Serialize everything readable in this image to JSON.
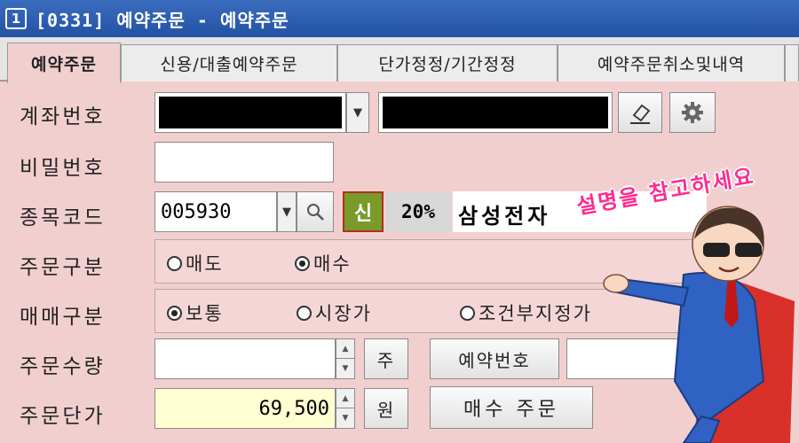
{
  "window": {
    "number": "1",
    "title": "[0331] 예약주문 - 예약주문"
  },
  "tabs": [
    {
      "label": "예약주문",
      "active": true
    },
    {
      "label": "신용/대출예약주문",
      "active": false
    },
    {
      "label": "단가정정/기간정정",
      "active": false
    },
    {
      "label": "예약주문취소및내역",
      "active": false
    }
  ],
  "form": {
    "account_label": "계좌번호",
    "password_label": "비밀번호",
    "stock_code_label": "종목코드",
    "stock_code_value": "005930",
    "credit_badge": "신",
    "margin_rate": "20%",
    "stock_name": "삼성전자",
    "order_type_label": "주문구분",
    "order_type_options": [
      "매도",
      "매수"
    ],
    "order_type_selected": "매수",
    "trade_type_label": "매매구분",
    "trade_type_options": [
      "보통",
      "시장가",
      "조건부지정가"
    ],
    "trade_type_selected": "보통",
    "quantity_label": "주문수량",
    "quantity_unit": "주",
    "reservation_no_label": "예약번호",
    "price_label": "주문단가",
    "price_value": "69,500",
    "price_unit": "원",
    "submit_label": "매수 주문"
  },
  "callout_text": "설명을 참고하세요",
  "colors": {
    "titlebar": "#2f5fb3",
    "panel": "#f2cfcf",
    "price_field": "#ffffd2",
    "credit_badge": "#7a9a2a"
  }
}
